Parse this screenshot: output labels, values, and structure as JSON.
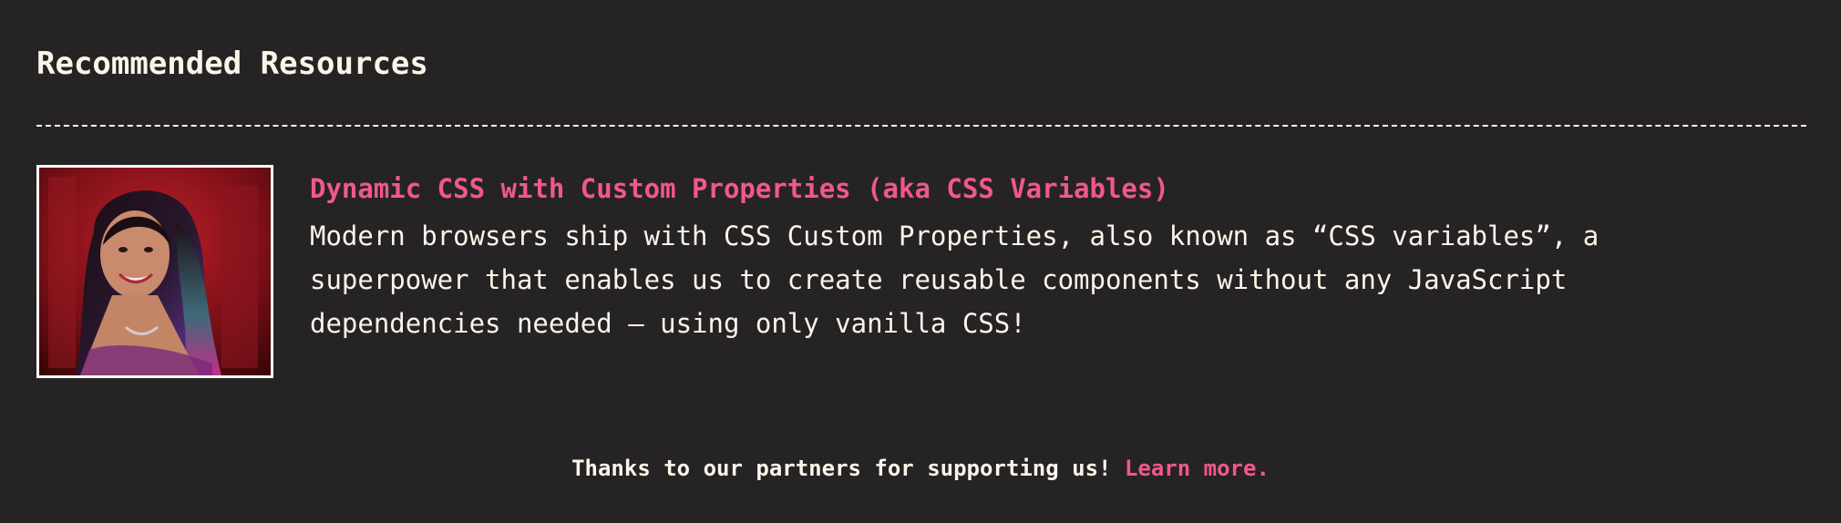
{
  "section": {
    "title": "Recommended Resources"
  },
  "resource": {
    "title": "Dynamic CSS with Custom Properties (aka CSS Variables)",
    "description_lines": [
      "Modern browsers ship with CSS Custom Properties, also known as “CSS variables”, a",
      "superpower that enables us to create reusable components without any JavaScript",
      "dependencies needed — using only vanilla CSS!"
    ]
  },
  "footer": {
    "text": "Thanks to our partners for supporting us!",
    "link_label": "Learn more."
  },
  "colors": {
    "background": "#262324",
    "text": "#fbf5e9",
    "accent": "#f1588a"
  }
}
